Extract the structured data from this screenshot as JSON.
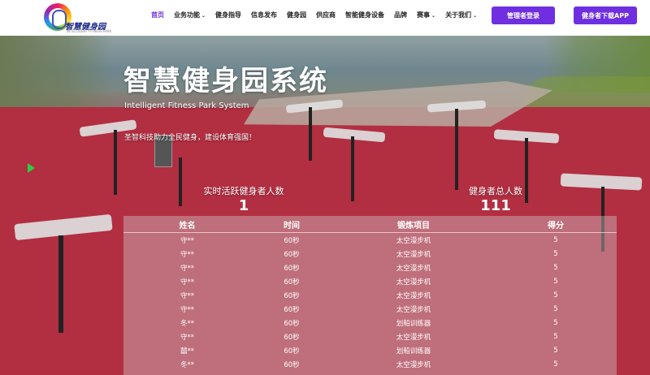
{
  "header": {
    "logo_text": "智慧健身园",
    "logo_sub": "INTELLIGENT FITNESS PARK",
    "nav": [
      {
        "label": "首页",
        "active": true,
        "caret": false
      },
      {
        "label": "业务功能",
        "active": false,
        "caret": true
      },
      {
        "label": "健身指导",
        "active": false,
        "caret": false
      },
      {
        "label": "信息发布",
        "active": false,
        "caret": false
      },
      {
        "label": "健身园",
        "active": false,
        "caret": false
      },
      {
        "label": "供应商",
        "active": false,
        "caret": false
      },
      {
        "label": "智能健身设备",
        "active": false,
        "caret": false
      },
      {
        "label": "品牌",
        "active": false,
        "caret": false
      },
      {
        "label": "赛事",
        "active": false,
        "caret": true
      },
      {
        "label": "关于我们",
        "active": false,
        "caret": true
      }
    ],
    "caret_glyph": "⌄",
    "login_button": "管理者登录",
    "app_button": "健身者下载APP"
  },
  "hero": {
    "title": "智慧健身园系统",
    "subtitle_en": "Intelligent Fitness Park System",
    "slogan": "圣智科技助力全民健身，建设体育强国！"
  },
  "stats": {
    "active_label": "实时活跃健身者人数",
    "active_value": "1",
    "total_label": "健身者总人数",
    "total_value": "111"
  },
  "table": {
    "headers": [
      "姓名",
      "时间",
      "锻炼项目",
      "得分"
    ],
    "rows": [
      [
        "守**",
        "60秒",
        "太空漫步机",
        "5"
      ],
      [
        "守**",
        "60秒",
        "太空漫步机",
        "5"
      ],
      [
        "守**",
        "60秒",
        "太空漫步机",
        "5"
      ],
      [
        "守**",
        "60秒",
        "太空漫步机",
        "5"
      ],
      [
        "守**",
        "60秒",
        "太空漫步机",
        "5"
      ],
      [
        "守**",
        "60秒",
        "太空漫步机",
        "5"
      ],
      [
        "冬**",
        "60秒",
        "划船训练器",
        "5"
      ],
      [
        "守**",
        "60秒",
        "太空漫步机",
        "5"
      ],
      [
        "囍**",
        "60秒",
        "划船训练器",
        "5"
      ],
      [
        "冬**",
        "60秒",
        "太空漫步机",
        "5"
      ]
    ]
  },
  "colors": {
    "accent": "#6f2fe0",
    "floor_red": "#b22e41"
  }
}
